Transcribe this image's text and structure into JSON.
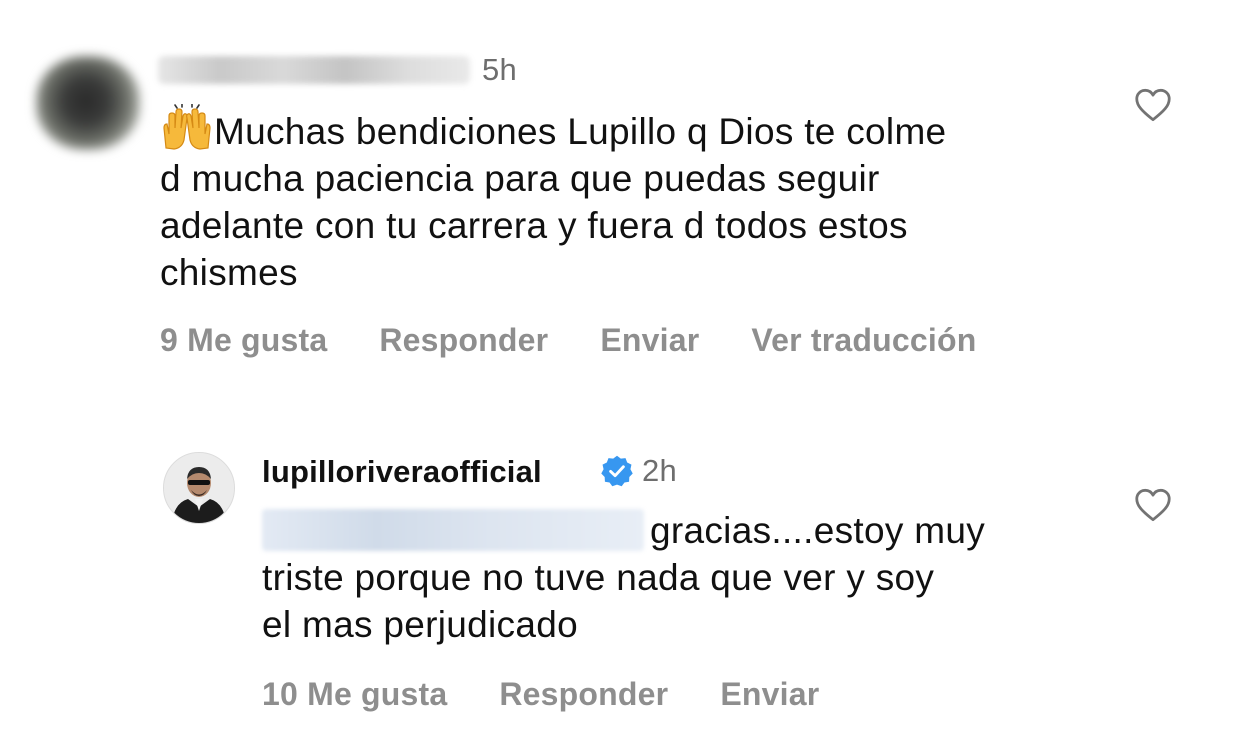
{
  "comments": [
    {
      "time": "5h",
      "text": "Muchas bendiciones Lupillo q Dios te colme d mucha paciencia para que puedas seguir adelante con tu carrera y fuera d todos estos chismes",
      "lines": [
        "Muchas bendiciones Lupillo q Dios te colme",
        "d mucha paciencia para que puedas seguir",
        "adelante con tu carrera y fuera d todos estos",
        "chismes"
      ],
      "emoji": "raising-hands-emoji",
      "likes_label": "9 Me gusta",
      "reply_label": "Responder",
      "send_label": "Enviar",
      "translate_label": "Ver traducción"
    },
    {
      "username": "lupilloriveraofficial",
      "verified": true,
      "time": "2h",
      "lines": [
        "gracias....estoy muy",
        "triste porque no tuve nada que ver y soy",
        "el mas perjudicado"
      ],
      "likes_label": "10 Me gusta",
      "reply_label": "Responder",
      "send_label": "Enviar"
    }
  ],
  "colors": {
    "verified_blue": "#3797f0",
    "muted": "#8e8e8e",
    "text": "#111111"
  }
}
